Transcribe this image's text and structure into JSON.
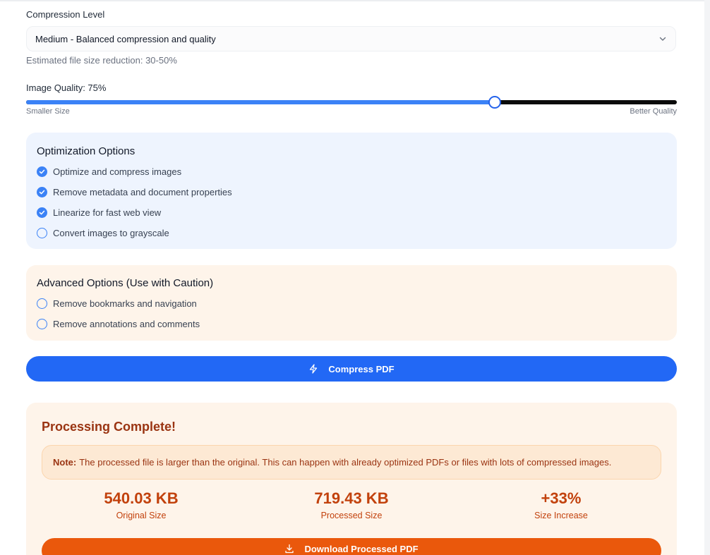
{
  "compression": {
    "label": "Compression Level",
    "selected": "Medium - Balanced compression and quality",
    "hint": "Estimated file size reduction: 30-50%"
  },
  "quality": {
    "label": "Image Quality: 75%",
    "value_percent": 72,
    "min_label": "Smaller Size",
    "max_label": "Better Quality"
  },
  "optimization": {
    "title": "Optimization Options",
    "options": [
      {
        "label": "Optimize and compress images",
        "checked": true
      },
      {
        "label": "Remove metadata and document properties",
        "checked": true
      },
      {
        "label": "Linearize for fast web view",
        "checked": true
      },
      {
        "label": "Convert images to grayscale",
        "checked": false
      }
    ]
  },
  "advanced": {
    "title": "Advanced Options (Use with Caution)",
    "options": [
      {
        "label": "Remove bookmarks and navigation",
        "checked": false
      },
      {
        "label": "Remove annotations and comments",
        "checked": false
      }
    ]
  },
  "actions": {
    "compress_label": "Compress PDF",
    "download_label": "Download Processed PDF"
  },
  "result": {
    "title": "Processing Complete!",
    "note_label": "Note:",
    "note_text": "The processed file is larger than the original. This can happen with already optimized PDFs or files with lots of compressed images.",
    "stats": [
      {
        "value": "540.03 KB",
        "label": "Original Size"
      },
      {
        "value": "719.43 KB",
        "label": "Processed Size"
      },
      {
        "value": "+33%",
        "label": "Size Increase"
      }
    ]
  },
  "colors": {
    "accent_blue": "#2268f5",
    "accent_orange": "#ea580c",
    "result_text": "#c2410c"
  },
  "icons": {
    "chevron": "chevron-down-icon",
    "bolt": "lightning-icon",
    "download": "download-icon",
    "check": "check-circle-icon"
  }
}
